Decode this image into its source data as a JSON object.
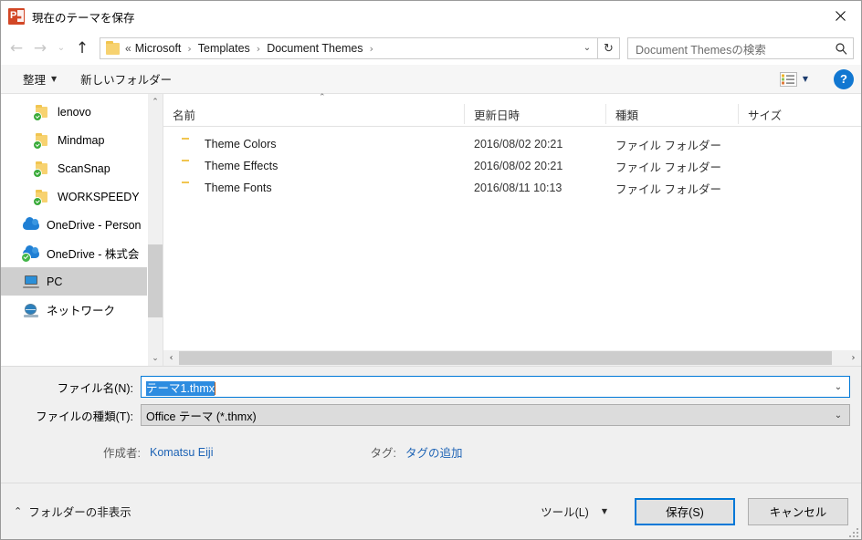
{
  "window": {
    "title": "現在のテーマを保存",
    "app_icon": "powerpoint-icon",
    "close_label": "✕",
    "accent_color": "#0078d7",
    "app_icon_color": "#d24726"
  },
  "nav": {
    "back_label": "←",
    "forward_label": "→",
    "recent_label": "⌄",
    "up_label": "↑",
    "refresh_label": "↻",
    "address_dropdown": "⌄",
    "breadcrumb_prefix": "«",
    "breadcrumb": [
      "Microsoft",
      "Templates",
      "Document Themes"
    ],
    "breadcrumb_separator": "›",
    "trailing_separator": "›"
  },
  "search": {
    "placeholder": "Document Themesの検索",
    "icon": "search-icon"
  },
  "commandbar": {
    "organize_label": "整理",
    "organize_caret": "▼",
    "new_folder_label": "新しいフォルダー",
    "view_caret": "▼",
    "help_label": "?"
  },
  "sidebar": {
    "items": [
      {
        "label": "lenovo",
        "icon": "folder-sync-icon",
        "indent": true,
        "selected": false
      },
      {
        "label": "Mindmap",
        "icon": "folder-sync-icon",
        "indent": true,
        "selected": false
      },
      {
        "label": "ScanSnap",
        "icon": "folder-sync-icon",
        "indent": true,
        "selected": false
      },
      {
        "label": "WORKSPEEDY",
        "icon": "folder-sync-icon",
        "indent": true,
        "selected": false
      },
      {
        "label": "OneDrive - Person",
        "icon": "onedrive-cloud-icon",
        "indent": false,
        "selected": false
      },
      {
        "label": "OneDrive - 株式会",
        "icon": "onedrive-cloud-sync-icon",
        "indent": false,
        "selected": false
      },
      {
        "label": "PC",
        "icon": "pc-monitor-icon",
        "indent": false,
        "selected": true
      },
      {
        "label": "ネットワーク",
        "icon": "network-globe-icon",
        "indent": false,
        "selected": false
      }
    ],
    "scroll_up": "⌃",
    "scroll_down": "⌄"
  },
  "filelist": {
    "sort_indicator": "⌃",
    "columns": [
      {
        "key": "name",
        "label": "名前"
      },
      {
        "key": "date",
        "label": "更新日時"
      },
      {
        "key": "type",
        "label": "種類"
      },
      {
        "key": "size",
        "label": "サイズ"
      }
    ],
    "rows": [
      {
        "name": "Theme Colors",
        "date": "2016/08/02 20:21",
        "type": "ファイル フォルダー",
        "size": ""
      },
      {
        "name": "Theme Effects",
        "date": "2016/08/02 20:21",
        "type": "ファイル フォルダー",
        "size": ""
      },
      {
        "name": "Theme Fonts",
        "date": "2016/08/11 10:13",
        "type": "ファイル フォルダー",
        "size": ""
      }
    ],
    "hscroll_left": "‹",
    "hscroll_right": "›"
  },
  "form": {
    "filename_label": "ファイル名(N):",
    "filename_value": "テーマ1.thmx",
    "filetype_label": "ファイルの種類(T):",
    "filetype_value": "Office テーマ (*.thmx)",
    "dropdown_caret": "⌄",
    "author_label": "作成者:",
    "author_value": "Komatsu Eiji",
    "tags_label": "タグ:",
    "tags_value": "タグの追加"
  },
  "footer": {
    "hide_folders_caret": "⌃",
    "hide_folders_label": "フォルダーの非表示",
    "tools_label": "ツール(L)",
    "tools_caret": "▼",
    "save_label": "保存(S)",
    "cancel_label": "キャンセル"
  }
}
